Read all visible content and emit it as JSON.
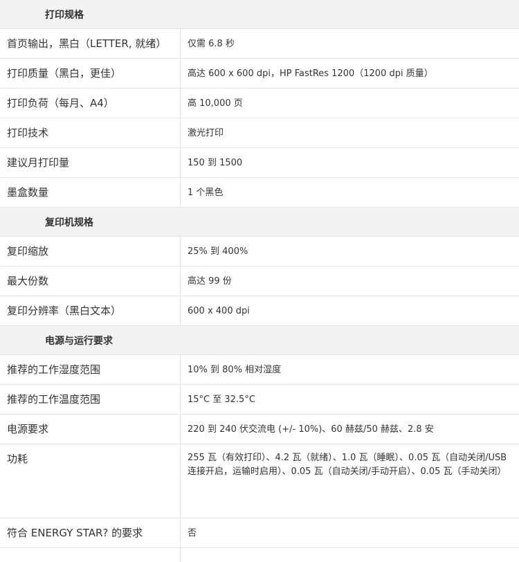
{
  "sections": [
    {
      "title": "打印规格",
      "rows": [
        {
          "label": "首页输出，黑白（LETTER, 就绪）",
          "value": "仅需 6.8 秒"
        },
        {
          "label": "打印质量（黑白，更佳）",
          "value": "高达 600 x 600 dpi，HP FastRes 1200（1200 dpi 质量）"
        },
        {
          "label": "打印负荷（每月、A4）",
          "value": "高 10,000 页"
        },
        {
          "label": "打印技术",
          "value": "激光打印"
        },
        {
          "label": "建议月打印量",
          "value": "150 到 1500"
        },
        {
          "label": "墨盒数量",
          "value": "1 个黑色"
        }
      ]
    },
    {
      "title": "复印机规格",
      "rows": [
        {
          "label": "复印缩放",
          "value": "25% 到 400%"
        },
        {
          "label": "最大份数",
          "value": "高达 99 份"
        },
        {
          "label": "复印分辨率（黑白文本）",
          "value": "600 x 400 dpi"
        }
      ]
    },
    {
      "title": "电源与运行要求",
      "rows": [
        {
          "label": "推荐的工作湿度范围",
          "value": "10% 到 80% 相对湿度"
        },
        {
          "label": "推荐的工作温度范围",
          "value": "15°C 至 32.5°C"
        },
        {
          "label": "电源要求",
          "value": "220 到 240 伏交流电 (+/- 10%)、60 赫兹/50 赫兹、2.8 安"
        },
        {
          "label": "功耗",
          "value": "255 瓦（有效打印）、4.2 瓦（就绪）、1.0 瓦（睡眠）、0.05 瓦（自动关闭/USB 连接开启，运输时启用）、0.05 瓦（自动关闭/手动开启）、0.05 瓦（手动关闭）"
        },
        {
          "label": "符合 ENERGY STAR? 的要求",
          "value": "否"
        }
      ]
    }
  ]
}
